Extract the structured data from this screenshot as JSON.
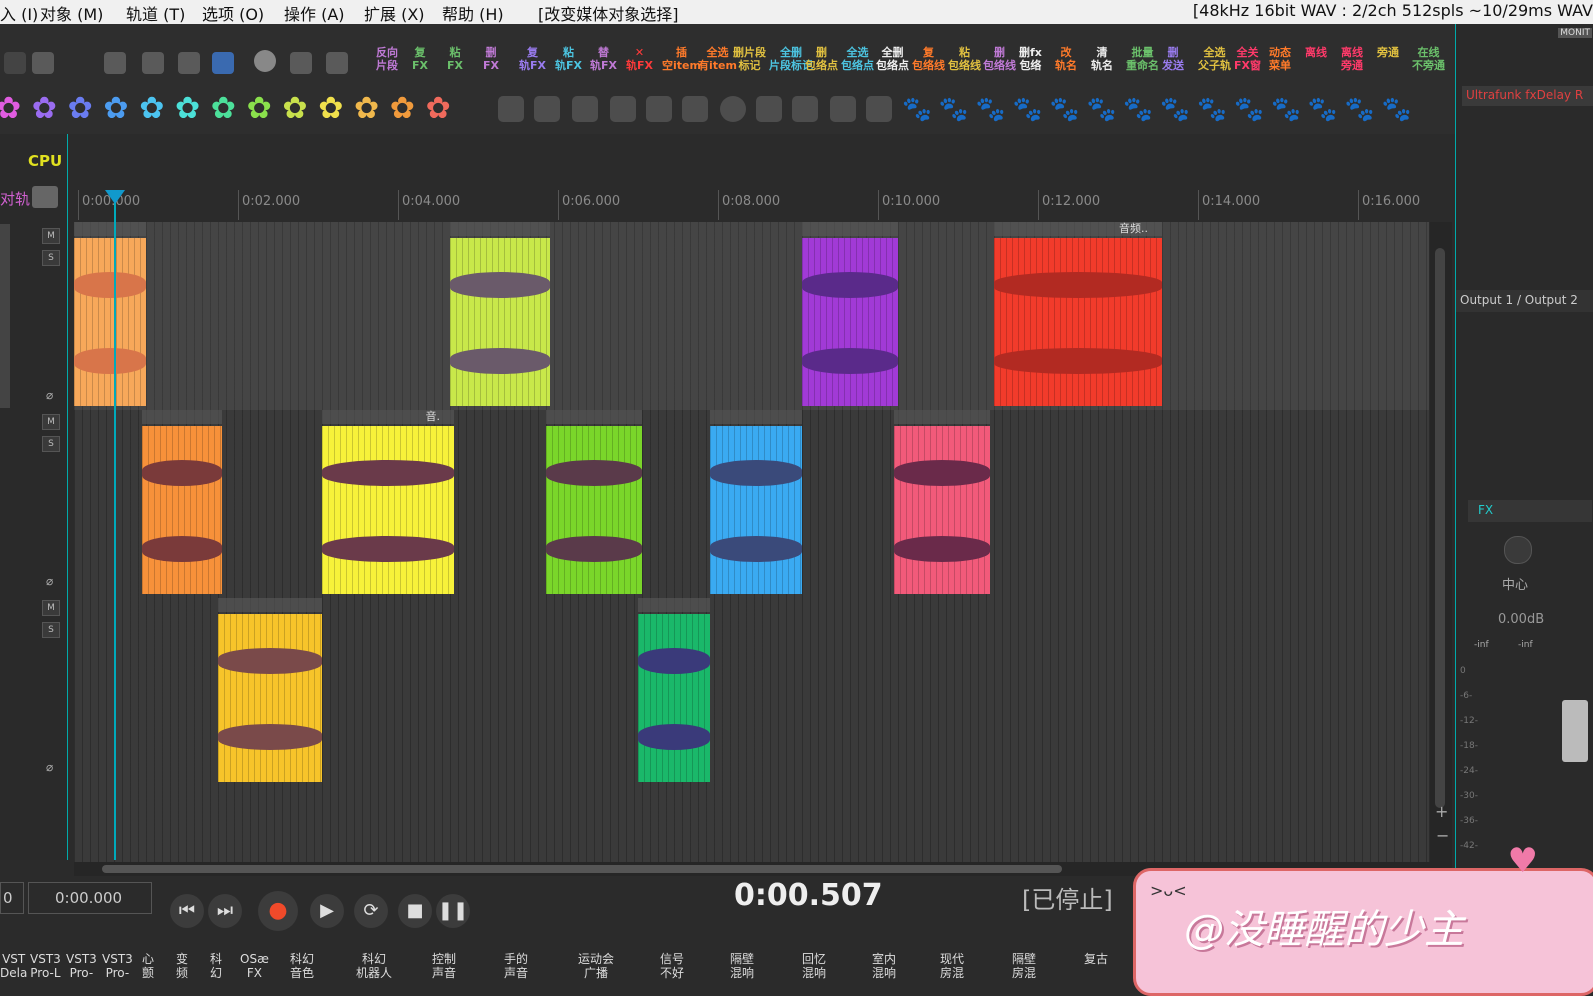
{
  "menubar": {
    "items": [
      "入 (I)",
      "对象 (M)",
      "轨道 (T)",
      "选项 (O)",
      "操作 (A)",
      "扩展 (X)",
      "帮助 (H)"
    ],
    "action_hint": "[改变媒体对象选择]",
    "status": "[48kHz 16bit WAV : 2/2ch 512spls ~10/29ms WAV"
  },
  "toolbar1": {
    "buttons": [
      {
        "label": "反向\n片段",
        "color": "#c07ad6"
      },
      {
        "label": "复\nFX",
        "color": "#6bc06b"
      },
      {
        "label": "粘\nFX",
        "color": "#6bc06b"
      },
      {
        "label": "删\nFX",
        "color": "#c07ad6"
      },
      {
        "label": "复\n轨FX",
        "color": "#9a7cf0"
      },
      {
        "label": "粘\n轨FX",
        "color": "#4cc4e0"
      },
      {
        "label": "替\n轨FX",
        "color": "#c07ad6"
      },
      {
        "label": "✕\n轨FX",
        "color": "#ff3a3a"
      },
      {
        "label": "插\n空item",
        "color": "#ff7a2a"
      },
      {
        "label": "全选\n有item",
        "color": "#ff7a2a"
      },
      {
        "label": "删片段\n标记",
        "color": "#e0c040"
      },
      {
        "label": "全删\n片段标记",
        "color": "#4cc4e0"
      },
      {
        "label": "删\n包络点",
        "color": "#e0c040"
      },
      {
        "label": "全选\n包络点",
        "color": "#4cc4e0"
      },
      {
        "label": "全删\n包络点",
        "color": "#eeeeee"
      },
      {
        "label": "复\n包络线",
        "color": "#ff7a2a"
      },
      {
        "label": "粘\n包络线",
        "color": "#e0c040"
      },
      {
        "label": "删\n包络线",
        "color": "#c07ad6"
      },
      {
        "label": "删fx\n包络",
        "color": "#eeeeee"
      },
      {
        "label": "改\n轨名",
        "color": "#ff7a2a"
      },
      {
        "label": "清\n轨名",
        "color": "#eeeeee"
      },
      {
        "label": "批量\n重命名",
        "color": "#6bc06b"
      },
      {
        "label": "删\n发送",
        "color": "#9a7cf0"
      },
      {
        "label": "全选\n父子轨",
        "color": "#e0c040"
      },
      {
        "label": "全关\nFX窗",
        "color": "#ff3a6a"
      },
      {
        "label": "动态\n菜单",
        "color": "#ff7a2a"
      },
      {
        "label": "离线",
        "color": "#ff3a6a"
      },
      {
        "label": "离线\n旁通",
        "color": "#ff3a6a"
      },
      {
        "label": "旁通",
        "color": "#e0c040"
      },
      {
        "label": "在线\n不旁通",
        "color": "#6bc06b"
      }
    ]
  },
  "toolbar2": {
    "flower_colors": [
      "#e05ce0",
      "#9a6cf0",
      "#6a7cf0",
      "#4c9cf0",
      "#4cc4f0",
      "#4ce0d8",
      "#4ce09a",
      "#8ae04c",
      "#c8e04c",
      "#f0e04c",
      "#f0b84c",
      "#f09a3c",
      "#f06a5c"
    ],
    "paw_colors": [
      "#f06a4c",
      "#f0a04c",
      "#f0c84c",
      "#e8e04c",
      "#b8e04c",
      "#7ae05c",
      "#4ce0a0",
      "#4cd8d8",
      "#4cb8f0",
      "#4c8cf0",
      "#7a6cf0",
      "#a86cf0",
      "#e06cd8",
      "#f06ab0"
    ]
  },
  "tcp": {
    "cpu_label": "CPU",
    "track_label": "对轨",
    "mute_label": "M",
    "solo_label": "S"
  },
  "ruler": {
    "ticks": [
      "0:00.000",
      "0:02.000",
      "0:04.000",
      "0:06.000",
      "0:08.000",
      "0:10.000",
      "0:12.000",
      "0:14.000",
      "0:16.000"
    ]
  },
  "items": [
    {
      "lane": 0,
      "start": 0.0,
      "end": 0.9,
      "color": "#f7a85a",
      "wave": "#d8754a",
      "name": ""
    },
    {
      "lane": 0,
      "start": 4.7,
      "end": 5.95,
      "color": "#c8e84a",
      "wave": "#6a5a6a",
      "name": ""
    },
    {
      "lane": 0,
      "start": 9.1,
      "end": 10.3,
      "color": "#a13ad6",
      "wave": "#5a2a8a",
      "name": ""
    },
    {
      "lane": 0,
      "start": 11.5,
      "end": 13.6,
      "color": "#f23b2b",
      "wave": "#b22a22",
      "name": "音频.."
    },
    {
      "lane": 1,
      "start": 0.85,
      "end": 1.85,
      "color": "#f7913a",
      "wave": "#7a3a3a",
      "name": ""
    },
    {
      "lane": 1,
      "start": 3.1,
      "end": 4.75,
      "color": "#f7f23a",
      "wave": "#6a3a4a",
      "name": "音."
    },
    {
      "lane": 1,
      "start": 5.9,
      "end": 7.1,
      "color": "#7ad62a",
      "wave": "#5a3a4a",
      "name": ""
    },
    {
      "lane": 1,
      "start": 7.95,
      "end": 9.1,
      "color": "#3aaaf2",
      "wave": "#3a4a7a",
      "name": ""
    },
    {
      "lane": 1,
      "start": 10.25,
      "end": 11.45,
      "color": "#f25a7a",
      "wave": "#6a2a4a",
      "name": ""
    },
    {
      "lane": 2,
      "start": 1.8,
      "end": 3.1,
      "color": "#f7c42a",
      "wave": "#7a4a4a",
      "name": ""
    },
    {
      "lane": 2,
      "start": 7.05,
      "end": 7.95,
      "color": "#1ab86a",
      "wave": "#3a3a7a",
      "name": ""
    }
  ],
  "mixer": {
    "monitor_label": "MONIT",
    "fx_plugin": "Ultrafunk fxDelay R",
    "output": "Output 1 / Output 2",
    "fx_label": "FX",
    "pan_label": "中心",
    "volume": "0.00dB",
    "meter_left": "-inf",
    "meter_right": "-inf",
    "scale": [
      "0",
      "-6-",
      "-12-",
      "-18-",
      "-24-",
      "-30-",
      "-36-",
      "-42-"
    ]
  },
  "transport": {
    "selection_start": "0",
    "selection_end": "0:00.000",
    "position": "0:00.507",
    "state": "[已停止]"
  },
  "bottombar": {
    "items": [
      "VST\nDela",
      "VST3\nPro-L",
      "VST3\nPro-",
      "VST3\nPro-",
      "心\n颤",
      "变\n频",
      "科\n幻",
      "OSæ\nFX",
      "科幻\n音色",
      "科幻\n机器人",
      "控制\n声音",
      "手的\n声音",
      "运动会\n广播",
      "信号\n不好",
      "隔壁\n混响",
      "回忆\n混响",
      "室内\n混响",
      "现代\n房混",
      "隔壁\n房混",
      "复古"
    ]
  },
  "watermark": {
    "text": "@没睡醒的少主",
    "face": ">ᴗ<"
  }
}
